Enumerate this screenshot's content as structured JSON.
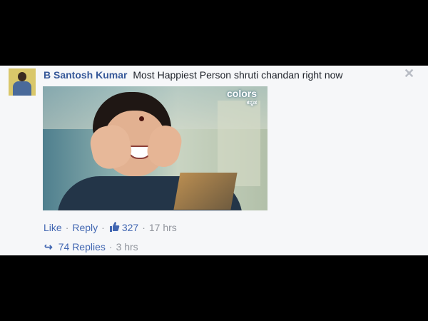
{
  "comment": {
    "author": "B Santosh Kumar",
    "text": "Most Happiest Person shruti chandan right now",
    "close_symbol": "✕"
  },
  "photo": {
    "channel_logo": "colors",
    "channel_sub": "ಕನ್ನಡ"
  },
  "actions": {
    "like_label": "Like",
    "reply_label": "Reply",
    "like_count": "327",
    "time": "17 hrs",
    "separator": "·"
  },
  "replies": {
    "count_label": "74 Replies",
    "time": "3 hrs"
  },
  "colors": {
    "link_blue": "#4267b2",
    "author_blue": "#365899",
    "meta_gray": "#90949c",
    "card_bg": "#f6f7f9",
    "page_bg": "#000000"
  },
  "icons": [
    "avatar",
    "close-icon",
    "thumbs-up-icon",
    "reply-arrow-icon"
  ]
}
